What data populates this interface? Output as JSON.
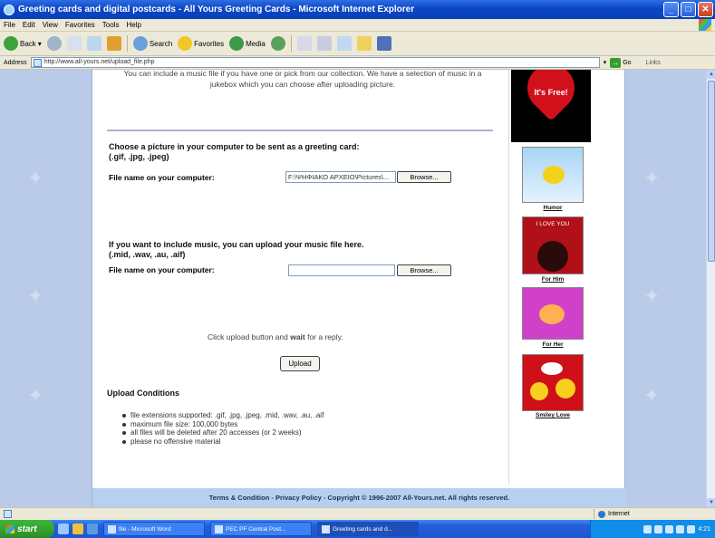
{
  "window": {
    "title": "Greeting cards and digital postcards - All Yours Greeting Cards - Microsoft Internet Explorer",
    "minimize": "_",
    "maximize": "□",
    "close": "✕"
  },
  "menu": [
    "File",
    "Edit",
    "View",
    "Favorites",
    "Tools",
    "Help"
  ],
  "toolbar": {
    "back": "Back",
    "search": "Search",
    "favorites": "Favorites",
    "media": "Media"
  },
  "address": {
    "label": "Address",
    "url": "http://www.all-yours.net/upload_file.php",
    "go": "Go",
    "links": "Links"
  },
  "content": {
    "intro": "You can include a music file if you have one or pick from our collection. We have a selection of music in a jukebox which you can choose after uploading picture.",
    "picture_heading": "Choose a picture in your computer to be sent as a greeting card:",
    "picture_types": "(.gif, .jpg, .jpeg)",
    "file_label_1": "File name on your computer:",
    "file_value_1": "F:\\ΨΗΦΙΑΚΟ ΑΡΧΕΙΟ\\Pictures\\...",
    "browse_1": "Browse...",
    "music_heading": "If you want to include music, you can upload your music file here.",
    "music_types": "(.mid, .wav, .au, .aif)",
    "file_label_2": "File name on your computer:",
    "file_value_2": "",
    "browse_2": "Browse...",
    "wait_text_pre": "Click upload button and ",
    "wait_text_bold": "wait",
    "wait_text_post": " for a reply.",
    "upload_button": "Upload",
    "conditions_heading": "Upload Conditions",
    "conditions": [
      "file extensions supported: .gif, .jpg, .jpeg, .mid, .wav, .au, .aif",
      "maximum file size: 100,000 bytes",
      "all files will be deleted after 20 accesses (or 2 weeks)",
      "please no offensive material"
    ]
  },
  "sidebar": {
    "free_badge": "It's Free!",
    "ads": [
      {
        "caption": "Humor"
      },
      {
        "caption": "For Him",
        "banner": "I LOVE YOU"
      },
      {
        "caption": "For Her"
      },
      {
        "caption": "Smiley Love"
      }
    ]
  },
  "footer": {
    "terms": "Terms & Condition",
    "privacy": "Privacy Policy",
    "copyright": "Copyright © 1996-2007 All-Yours.net. All rights reserved."
  },
  "status": {
    "zone": "Internet"
  },
  "taskbar": {
    "start": "start",
    "tasks": [
      "file - Microsoft Word",
      "PEC PF Central Post...",
      "Greeting cards and d..."
    ],
    "clock": "4:21"
  },
  "colors": {
    "title_blue": "#0a46c8",
    "page_bg": "#b9cbe9",
    "footer_bg": "#b8d0f0",
    "start_green": "#2a8d25"
  }
}
